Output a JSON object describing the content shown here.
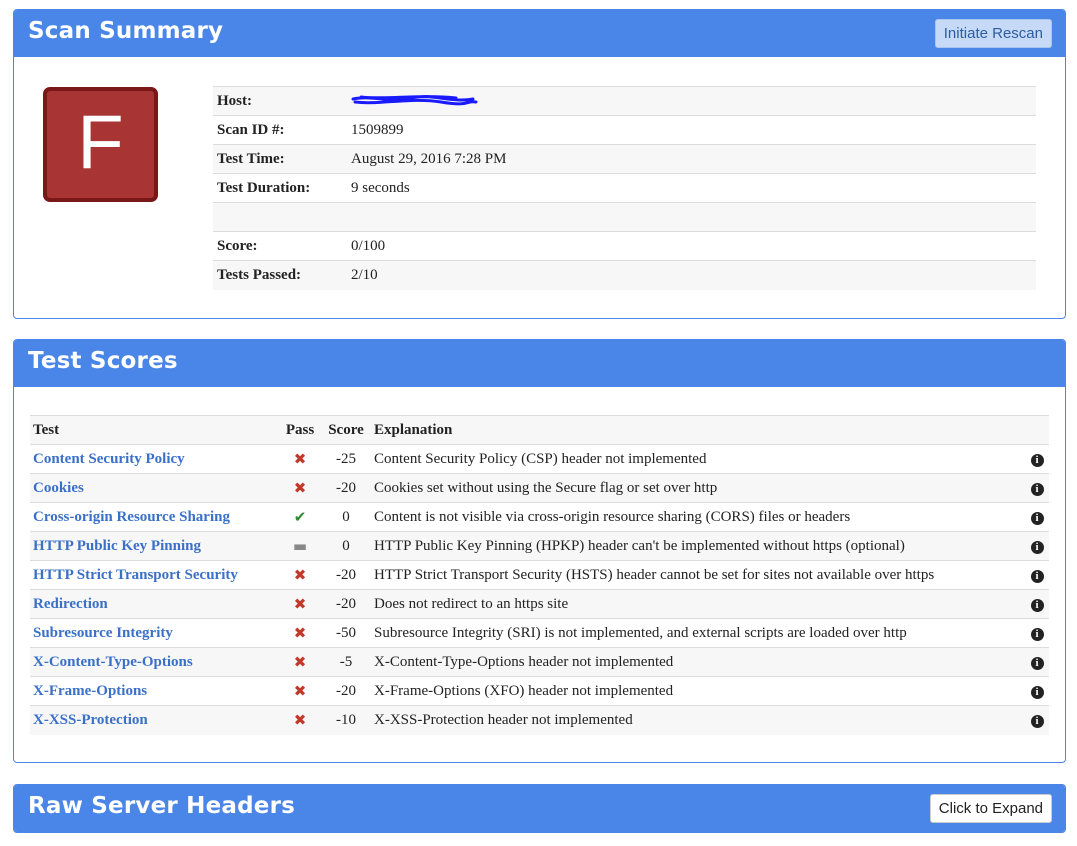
{
  "summary": {
    "title": "Scan Summary",
    "rescan_label": "Initiate Rescan",
    "grade": "F",
    "rows": [
      {
        "label": "Host:",
        "value": ""
      },
      {
        "label": "Scan ID #:",
        "value": "1509899"
      },
      {
        "label": "Test Time:",
        "value": "August 29, 2016 7:28 PM"
      },
      {
        "label": "Test Duration:",
        "value": "9 seconds"
      },
      {
        "label": "",
        "value": ""
      },
      {
        "label": "Score:",
        "value": "0/100"
      },
      {
        "label": "Tests Passed:",
        "value": "2/10"
      }
    ]
  },
  "scores": {
    "title": "Test Scores",
    "headers": {
      "test": "Test",
      "pass": "Pass",
      "score": "Score",
      "explanation": "Explanation"
    },
    "rows": [
      {
        "test": "Content Security Policy",
        "pass": "fail",
        "icon": "✖",
        "score": "-25",
        "explanation": "Content Security Policy (CSP) header not implemented"
      },
      {
        "test": "Cookies",
        "pass": "fail",
        "icon": "✖",
        "score": "-20",
        "explanation": "Cookies set without using the Secure flag or set over http"
      },
      {
        "test": "Cross-origin Resource Sharing",
        "pass": "ok",
        "icon": "✔",
        "score": "0",
        "explanation": "Content is not visible via cross-origin resource sharing (CORS) files or headers"
      },
      {
        "test": "HTTP Public Key Pinning",
        "pass": "na",
        "icon": "▬",
        "score": "0",
        "explanation": "HTTP Public Key Pinning (HPKP) header can't be implemented without https (optional)"
      },
      {
        "test": "HTTP Strict Transport Security",
        "pass": "fail",
        "icon": "✖",
        "score": "-20",
        "explanation": "HTTP Strict Transport Security (HSTS) header cannot be set for sites not available over https"
      },
      {
        "test": "Redirection",
        "pass": "fail",
        "icon": "✖",
        "score": "-20",
        "explanation": "Does not redirect to an https site"
      },
      {
        "test": "Subresource Integrity",
        "pass": "fail",
        "icon": "✖",
        "score": "-50",
        "explanation": "Subresource Integrity (SRI) is not implemented, and external scripts are loaded over http"
      },
      {
        "test": "X-Content-Type-Options",
        "pass": "fail",
        "icon": "✖",
        "score": "-5",
        "explanation": "X-Content-Type-Options header not implemented"
      },
      {
        "test": "X-Frame-Options",
        "pass": "fail",
        "icon": "✖",
        "score": "-20",
        "explanation": "X-Frame-Options (XFO) header not implemented"
      },
      {
        "test": "X-XSS-Protection",
        "pass": "fail",
        "icon": "✖",
        "score": "-10",
        "explanation": "X-XSS-Protection header not implemented"
      }
    ]
  },
  "raw": {
    "title": "Raw Server Headers",
    "expand_label": "Click to Expand"
  },
  "icons": {
    "info": "i"
  },
  "colors": {
    "panel_header": "#4a86e8",
    "grade_bg": "#a83434",
    "link": "#3a70c8",
    "fail": "#c0392b",
    "pass": "#2e8b2e"
  }
}
